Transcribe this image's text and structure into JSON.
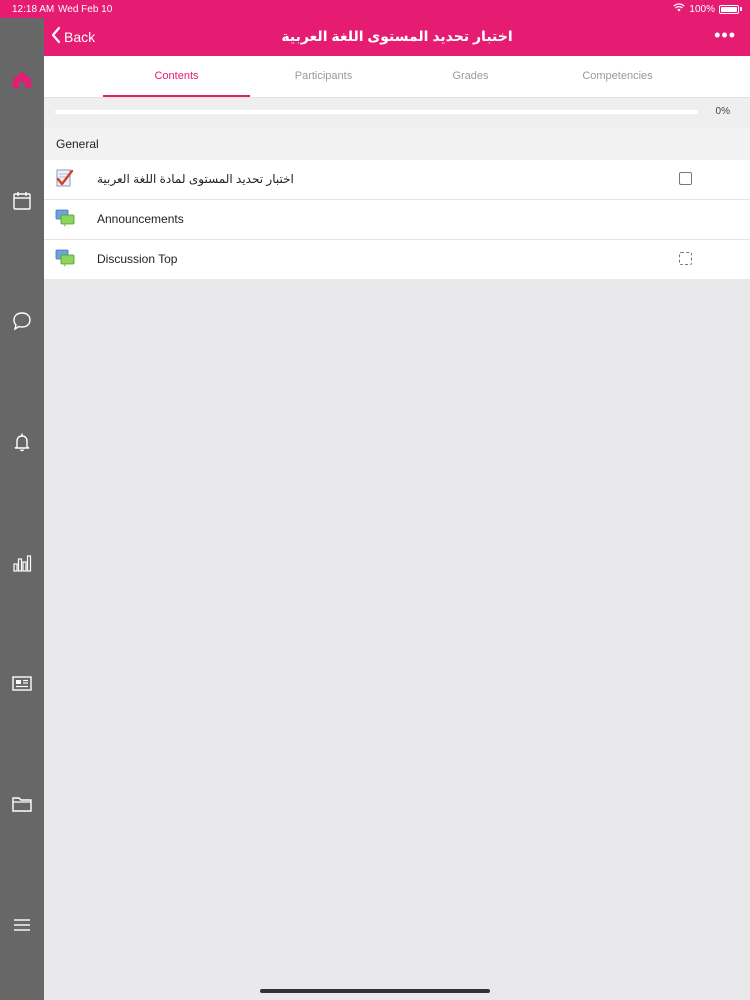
{
  "status_bar": {
    "time": "12:18 AM",
    "date": "Wed Feb 10",
    "battery": "100%"
  },
  "nav": {
    "back_label": "Back",
    "title": "اختبار تحديد المستوى اللغة العربية",
    "more_label": "•••"
  },
  "sidebar": {
    "icons": [
      "home-icon",
      "calendar-icon",
      "chat-icon",
      "bell-icon",
      "bar-chart-icon",
      "newspaper-icon",
      "folder-icon",
      "menu-icon"
    ]
  },
  "tabs": [
    {
      "label": "Contents",
      "active": true
    },
    {
      "label": "Participants",
      "active": false
    },
    {
      "label": "Grades",
      "active": false
    },
    {
      "label": "Competencies",
      "active": false
    }
  ],
  "progress": {
    "label": "0%",
    "value": 0
  },
  "section": {
    "title": "General"
  },
  "items": [
    {
      "label": "اختبار تحديد المستوى لمادة اللغة العربية",
      "icon": "quiz-icon",
      "completion": "manual"
    },
    {
      "label": "Announcements",
      "icon": "forum-icon",
      "completion": "none"
    },
    {
      "label": "Discussion Top",
      "icon": "forum-icon",
      "completion": "auto"
    }
  ],
  "colors": {
    "accent": "#e61c72",
    "sidebar": "#676767",
    "background": "#e9e8ea"
  }
}
